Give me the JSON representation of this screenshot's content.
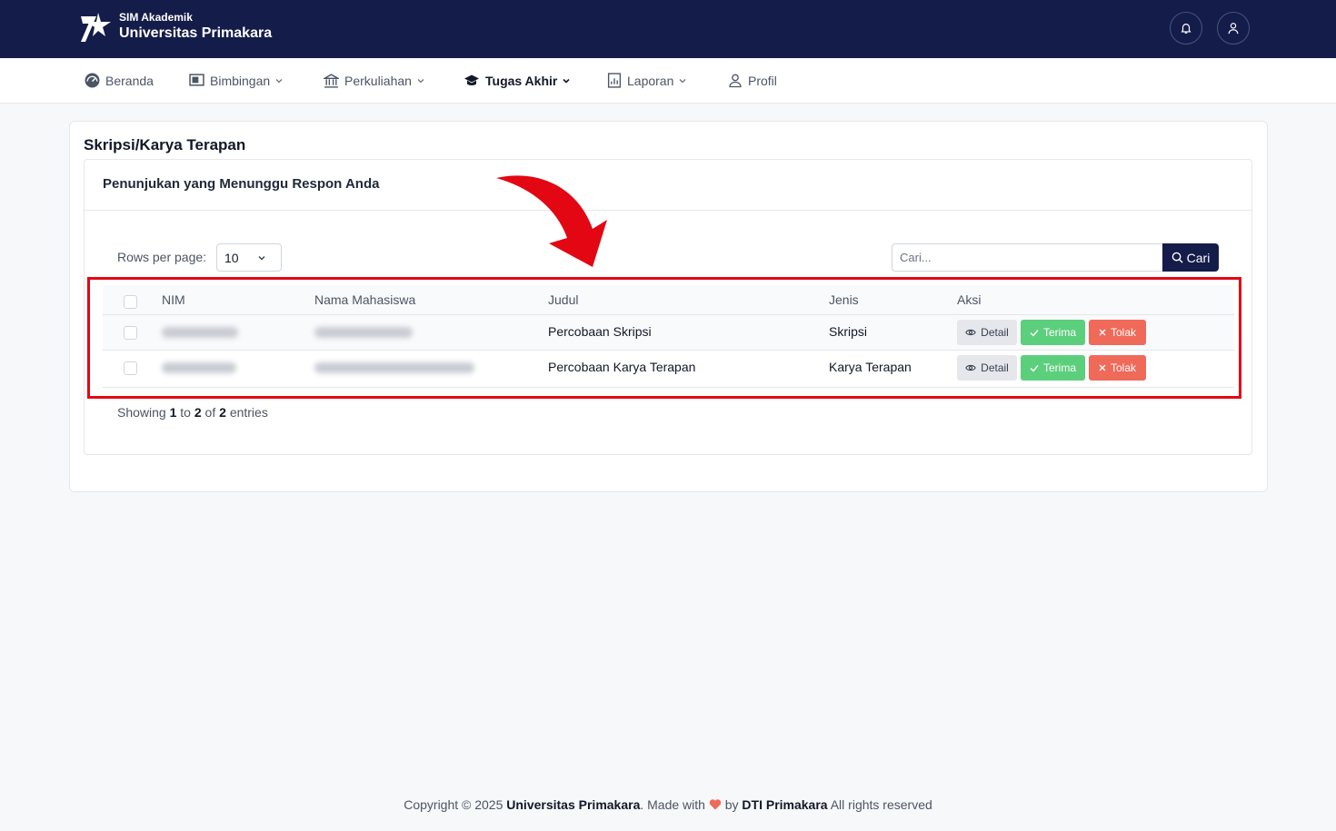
{
  "header": {
    "app_subtitle": "SIM Akademik",
    "app_title": "Universitas Primakara"
  },
  "nav": [
    {
      "label": "Beranda",
      "icon": "dashboard-icon"
    },
    {
      "label": "Bimbingan",
      "icon": "presentation-icon"
    },
    {
      "label": "Perkuliahan",
      "icon": "building-icon"
    },
    {
      "label": "Tugas Akhir",
      "icon": "graduation-cap-icon"
    },
    {
      "label": "Laporan",
      "icon": "report-icon"
    },
    {
      "label": "Profil",
      "icon": "user-icon"
    }
  ],
  "page": {
    "title": "Skripsi/Karya Terapan",
    "section_title": "Penunjukan yang Menunggu Respon Anda"
  },
  "table": {
    "rows_per_page_label": "Rows per page:",
    "rows_per_page_value": "10",
    "search_placeholder": "Cari...",
    "search_button": "Cari",
    "columns": [
      "NIM",
      "Nama Mahasiswa",
      "Judul",
      "Jenis",
      "Aksi"
    ],
    "rows": [
      {
        "judul": "Percobaan Skripsi",
        "jenis": "Skripsi"
      },
      {
        "judul": "Percobaan Karya Terapan",
        "jenis": "Karya Terapan"
      }
    ],
    "actions": {
      "detail": "Detail",
      "terima": "Terima",
      "tolak": "Tolak"
    },
    "showing": {
      "prefix": "Showing",
      "from": "1",
      "to_word": "to",
      "to": "2",
      "of_word": "of",
      "total": "2",
      "suffix": "entries"
    }
  },
  "footer": {
    "copyright": "Copyright © 2025",
    "org": "Universitas Primakara",
    "made_with": ". Made with",
    "by": "by",
    "team": "DTI Primakara",
    "rights": "All rights reserved"
  },
  "colors": {
    "navy": "#141c4a",
    "terima": "#5ccf7c",
    "tolak": "#f06a5a",
    "highlight": "#e30613"
  }
}
